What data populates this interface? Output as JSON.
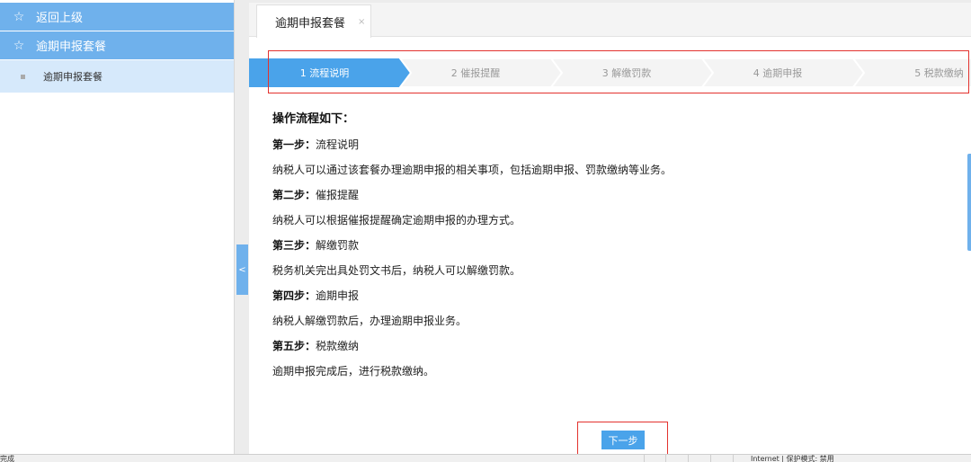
{
  "sidebar": {
    "back_label": "返回上级",
    "package_label": "逾期申报套餐",
    "sub_item_label": "逾期申报套餐",
    "star_icon": "star-outline-icon"
  },
  "tab": {
    "label": "逾期申报套餐",
    "close": "×"
  },
  "steps": [
    {
      "label": "1  流程说明",
      "active": true
    },
    {
      "label": "2  催报提醒",
      "active": false
    },
    {
      "label": "3  解缴罚款",
      "active": false
    },
    {
      "label": "4  逾期申报",
      "active": false
    },
    {
      "label": "5  税款缴纳",
      "active": false
    }
  ],
  "content": {
    "title": "操作流程如下：",
    "sections": [
      {
        "heading": "第一步：",
        "name": "流程说明",
        "desc": "纳税人可以通过该套餐办理逾期申报的相关事项，包括逾期申报、罚款缴纳等业务。"
      },
      {
        "heading": "第二步：",
        "name": "催报提醒",
        "desc": "纳税人可以根据催报提醒确定逾期申报的办理方式。"
      },
      {
        "heading": "第三步：",
        "name": "解缴罚款",
        "desc": "税务机关完出具处罚文书后，纳税人可以解缴罚款。"
      },
      {
        "heading": "第四步：",
        "name": "逾期申报",
        "desc": "纳税人解缴罚款后，办理逾期申报业务。"
      },
      {
        "heading": "第五步：",
        "name": "税款缴纳",
        "desc": "逾期申报完成后，进行税款缴纳。"
      }
    ]
  },
  "next_button": "下一步",
  "collapse_glyph": "<",
  "status": {
    "left": "完成",
    "zone": "Internet | 保护模式: 禁用"
  },
  "colors": {
    "accent": "#6fb1ec",
    "active_step": "#4aa3ea",
    "highlight": "#e3322e"
  }
}
